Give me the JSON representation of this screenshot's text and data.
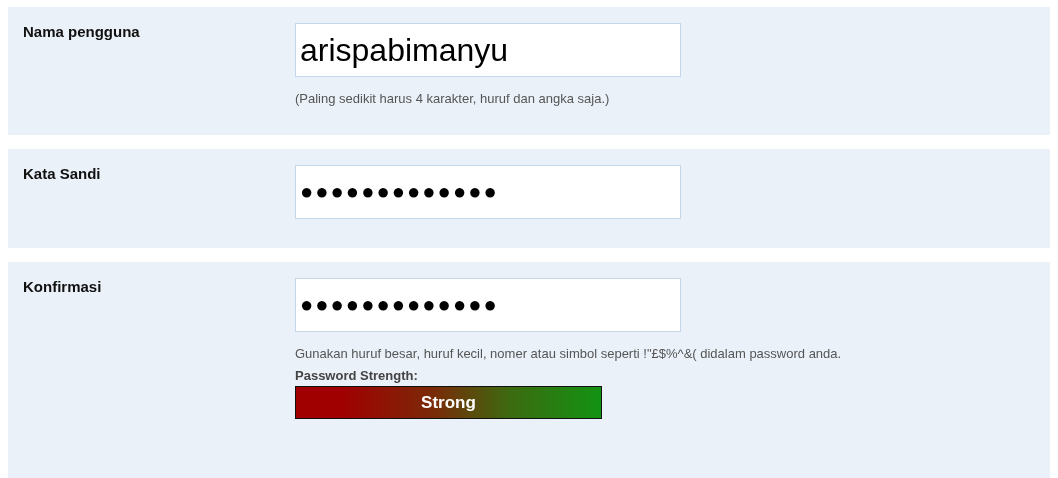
{
  "fields": [
    {
      "label": "Nama pengguna",
      "value": "arispabimanyu",
      "kind": "text",
      "hint": "(Paling sedikit harus 4 karakter, huruf dan angka saja.)"
    },
    {
      "label": "Kata Sandi",
      "value": "●●●●●●●●●●●●●",
      "kind": "password"
    },
    {
      "label": "Konfirmasi",
      "value": "●●●●●●●●●●●●●",
      "kind": "password",
      "hint": "Gunakan huruf besar, huruf kecil, nomer atau simbol seperti !\"£$%^&( didalam password anda."
    }
  ],
  "strength": {
    "label": "Password Strength:",
    "reading": "Strong",
    "level": 1
  }
}
